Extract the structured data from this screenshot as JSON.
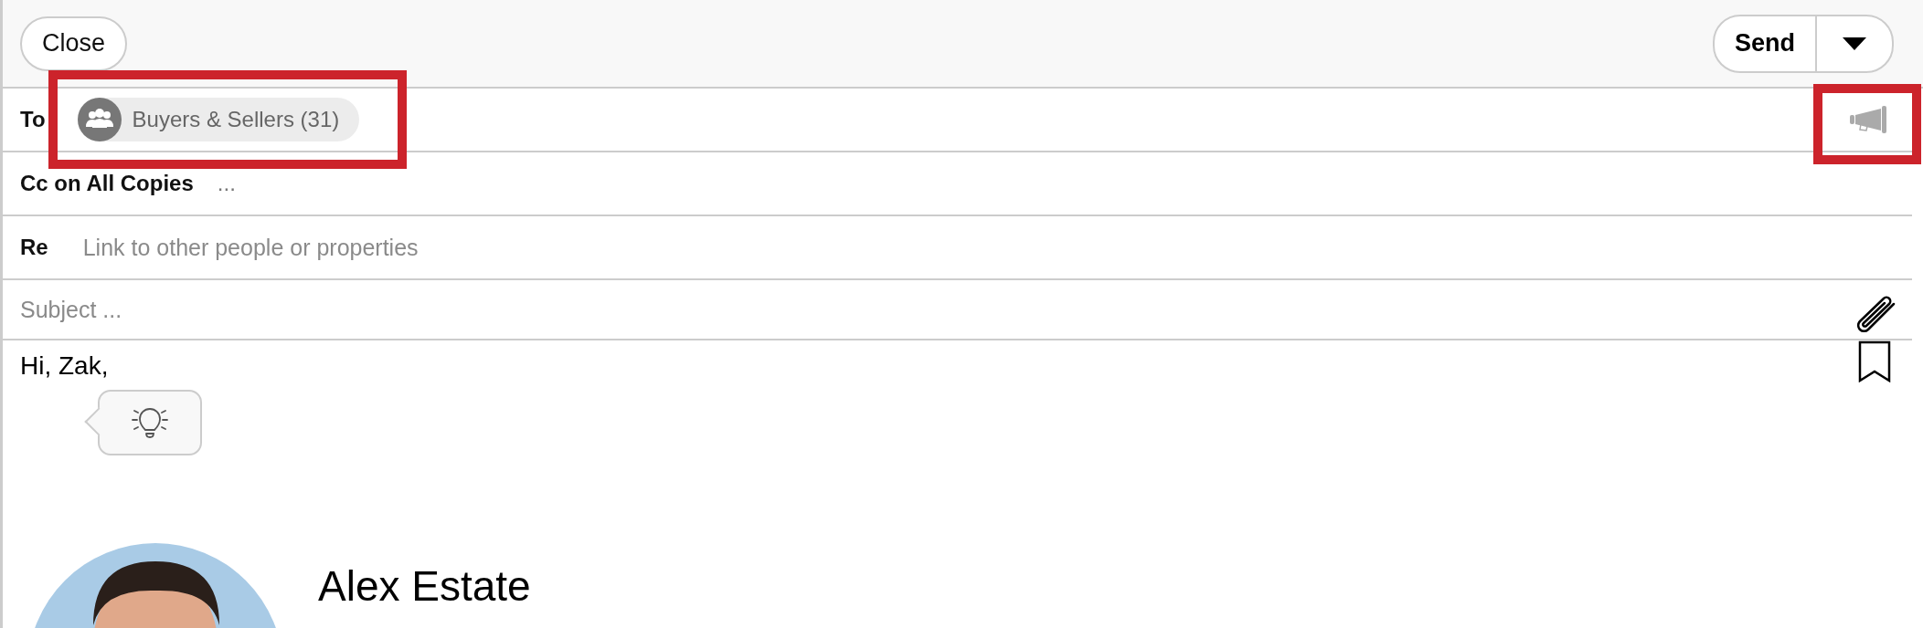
{
  "toolbar": {
    "close": "Close",
    "send": "Send"
  },
  "fields": [
    {
      "kind": "recipients",
      "label": "To",
      "chip": {
        "text": "Buyers & Sellers (31)",
        "highlighted": true
      },
      "action_highlighted": true
    },
    {
      "kind": "text",
      "label": "Cc on All Copies",
      "value": "..."
    },
    {
      "kind": "link",
      "label": "Re",
      "placeholder": "Link to other people or properties"
    }
  ],
  "subject": {
    "placeholder": "Subject ..."
  },
  "body": {
    "greeting": "Hi, Zak,",
    "signature_name": "Alex Estate"
  }
}
